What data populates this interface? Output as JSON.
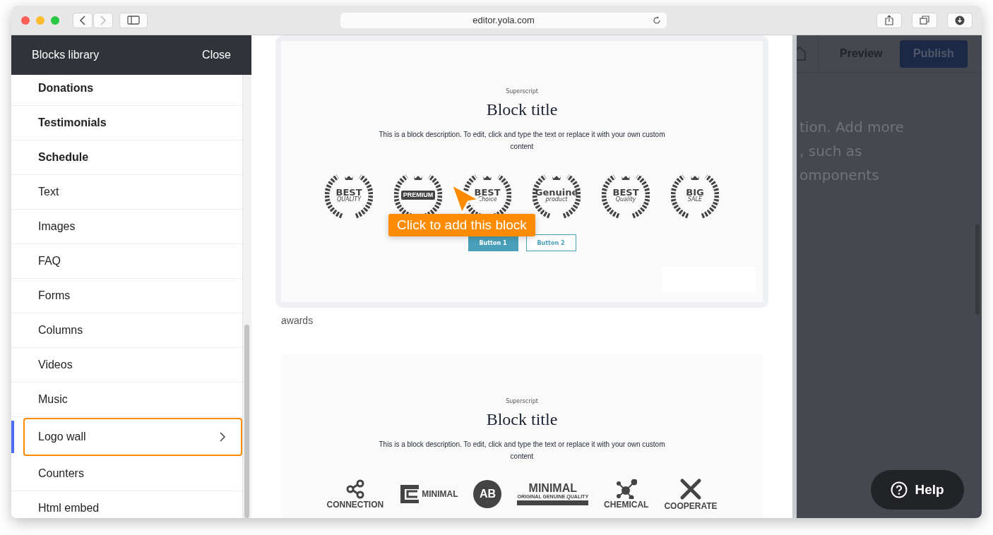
{
  "browser": {
    "url": "editor.yola.com"
  },
  "sidebar": {
    "title": "Blocks library",
    "close": "Close",
    "items": [
      {
        "label": "Donations",
        "bold": true,
        "selected": false
      },
      {
        "label": "Testimonials",
        "bold": true,
        "selected": false
      },
      {
        "label": "Schedule",
        "bold": true,
        "selected": false
      },
      {
        "label": "Text",
        "bold": false,
        "selected": false
      },
      {
        "label": "Images",
        "bold": false,
        "selected": false
      },
      {
        "label": "FAQ",
        "bold": false,
        "selected": false
      },
      {
        "label": "Forms",
        "bold": false,
        "selected": false
      },
      {
        "label": "Columns",
        "bold": false,
        "selected": false
      },
      {
        "label": "Videos",
        "bold": false,
        "selected": false
      },
      {
        "label": "Music",
        "bold": false,
        "selected": false
      },
      {
        "label": "Logo wall",
        "bold": false,
        "selected": true
      },
      {
        "label": "Counters",
        "bold": false,
        "selected": false
      },
      {
        "label": "Html embed",
        "bold": false,
        "selected": false
      }
    ]
  },
  "previews": [
    {
      "superscript": "Superscript",
      "title": "Block title",
      "description": "This is a block description. To edit, click and type the text or replace it with your own custom content",
      "logos": [
        {
          "kind": "award",
          "lines": [
            "BEST",
            "QUALITY"
          ]
        },
        {
          "kind": "award",
          "lines": [
            "PREMIUM"
          ]
        },
        {
          "kind": "award",
          "lines": [
            "BEST",
            "Choice"
          ]
        },
        {
          "kind": "award",
          "lines": [
            "Genuine",
            "product"
          ]
        },
        {
          "kind": "award",
          "lines": [
            "BEST",
            "Quality"
          ]
        },
        {
          "kind": "award",
          "lines": [
            "BIG",
            "SALE"
          ]
        }
      ],
      "buttons": [
        {
          "label": "Button 1",
          "kind": "filled"
        },
        {
          "label": "Button 2",
          "kind": "outline"
        }
      ],
      "caption": "awards"
    },
    {
      "superscript": "Superscript",
      "title": "Block title",
      "description": "This is a block description. To edit, click and type the text or replace it with your own custom content",
      "logos": [
        {
          "kind": "nodes",
          "lines": [
            "CONNECTION"
          ]
        },
        {
          "kind": "bracket",
          "lines": [
            "MINIMAL"
          ]
        },
        {
          "kind": "circle",
          "lines": [
            "AB"
          ]
        },
        {
          "kind": "banner",
          "lines": [
            "MINIMAL",
            "ORIGINAL GENUINE QUALITY"
          ]
        },
        {
          "kind": "molecule",
          "lines": [
            "CHEMICAL"
          ]
        },
        {
          "kind": "cross",
          "lines": [
            "COOPERATE"
          ]
        }
      ]
    }
  ],
  "tooltip": "Click to add this block",
  "editor": {
    "preview": "Preview",
    "publish": "Publish",
    "text_lines": [
      "tion. Add more",
      ", such as",
      "omponents"
    ]
  },
  "help": "Help"
}
